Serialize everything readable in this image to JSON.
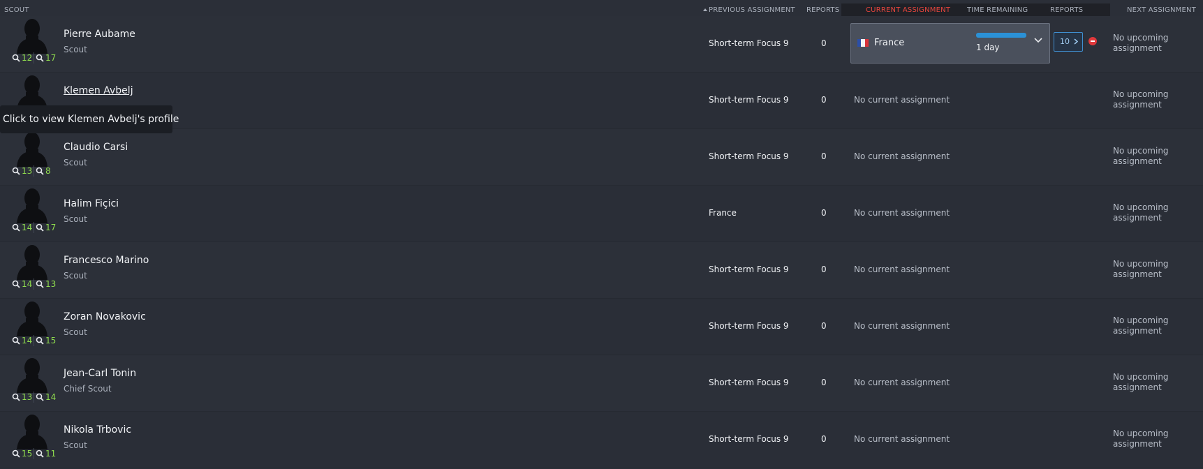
{
  "header": {
    "scout": "SCOUT",
    "previous_assignment": "PREVIOUS ASSIGNMENT",
    "reports": "REPORTS",
    "current_assignment": "CURRENT ASSIGNMENT",
    "time_remaining": "TIME REMAINING",
    "current_reports": "REPORTS",
    "next_assignment": "NEXT ASSIGNMENT"
  },
  "colors": {
    "accent_red": "#e8453c",
    "stat_green": "#8fdc4e",
    "progress_blue": "#2b91d6"
  },
  "tooltip": "Click to view Klemen Avbelj's profile",
  "scouts": [
    {
      "name": "Pierre Aubame",
      "role": "Scout",
      "stat1": "12",
      "stat2": "17",
      "previous": "Short-term Focus 9",
      "reports": "0",
      "current": null,
      "next": "No upcoming assignment"
    },
    {
      "name": "Klemen Avbelj",
      "role": "",
      "stat1": "",
      "stat2": "",
      "previous": "Short-term Focus 9",
      "reports": "0",
      "current": "No current assignment",
      "next": "No upcoming assignment"
    },
    {
      "name": "Claudio Carsi",
      "role": "Scout",
      "stat1": "13",
      "stat2": "8",
      "previous": "Short-term Focus 9",
      "reports": "0",
      "current": "No current assignment",
      "next": "No upcoming assignment"
    },
    {
      "name": "Halim Fiçici",
      "role": "Scout",
      "stat1": "14",
      "stat2": "17",
      "previous": "France",
      "reports": "0",
      "current": "No current assignment",
      "next": "No upcoming assignment"
    },
    {
      "name": "Francesco Marino",
      "role": "Scout",
      "stat1": "14",
      "stat2": "13",
      "previous": "Short-term Focus 9",
      "reports": "0",
      "current": "No current assignment",
      "next": "No upcoming assignment"
    },
    {
      "name": "Zoran Novakovic",
      "role": "Scout",
      "stat1": "14",
      "stat2": "15",
      "previous": "Short-term Focus 9",
      "reports": "0",
      "current": "No current assignment",
      "next": "No upcoming assignment"
    },
    {
      "name": "Jean-Carl Tonin",
      "role": "Chief Scout",
      "stat1": "13",
      "stat2": "14",
      "previous": "Short-term Focus 9",
      "reports": "0",
      "current": "No current assignment",
      "next": "No upcoming assignment"
    },
    {
      "name": "Nikola Trbovic",
      "role": "Scout",
      "stat1": "15",
      "stat2": "11",
      "previous": "Short-term Focus 9",
      "reports": "0",
      "current": "No current assignment",
      "next": "No upcoming assignment"
    }
  ],
  "active_assignment": {
    "country": "France",
    "time_remaining": "1 day",
    "progress_fraction": 1.0,
    "report_target": "10",
    "flag_icon": "france-flag-icon"
  }
}
